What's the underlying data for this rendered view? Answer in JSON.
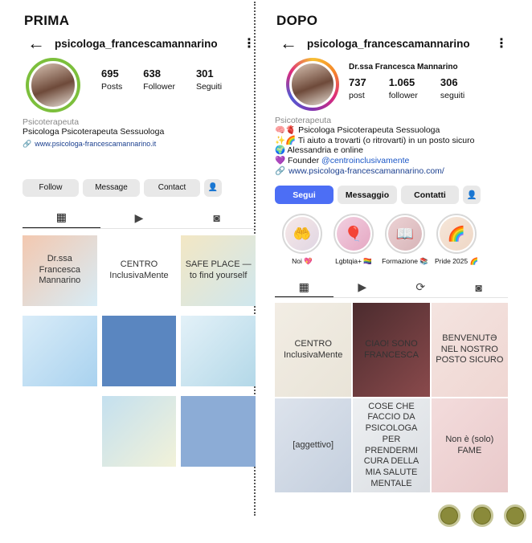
{
  "left_title": "PRIMA",
  "right_title": "DOPO",
  "before": {
    "username": "psicologa_francescamannarino",
    "stats": [
      {
        "num": "695",
        "label": "Posts"
      },
      {
        "num": "638",
        "label": "Follower"
      },
      {
        "num": "301",
        "label": "Seguiti"
      }
    ],
    "category": "Psicoterapeuta",
    "bio": "Psicologa Psicoterapeuta  Sessuologa",
    "link": "www.psicologa-francescamannarino.it",
    "buttons": {
      "follow": "Follow",
      "message": "Message",
      "contact": "Contact"
    },
    "posts": [
      {
        "text": "Dr.ssa Francesca Mannarino",
        "bg": "linear-gradient(135deg,#f3c8b0,#d7ecf6)"
      },
      {
        "text": "CENTRO InclusivaMente",
        "bg": "#ffffff"
      },
      {
        "text": "SAFE PLACE — to find yourself",
        "bg": "linear-gradient(135deg,#f3e7c4,#cfe7ee)"
      },
      {
        "text": "",
        "bg": "linear-gradient(135deg,#d9ecf8,#a9d2ef)"
      },
      {
        "text": "",
        "bg": "#5a86c0"
      },
      {
        "text": "",
        "bg": "linear-gradient(135deg,#e3f1f8,#b3d8e8)"
      },
      {
        "text": "",
        "bg": "#ffffff"
      },
      {
        "text": "",
        "bg": "linear-gradient(135deg,#c4e0ef,#f2f2d9)"
      },
      {
        "text": "",
        "bg": "#8cacd6"
      }
    ]
  },
  "after": {
    "username": "psicologa_francescamannarino",
    "full_name": "Dr.ssa Francesca Mannarino",
    "stats": [
      {
        "num": "737",
        "label": "post"
      },
      {
        "num": "1.065",
        "label": "follower"
      },
      {
        "num": "306",
        "label": "seguiti"
      }
    ],
    "category": "Psicoterapeuta",
    "bio_lines": [
      "🧠🫀 Psicologa Psicoterapeuta Sessuologa",
      "✨🌈 Ti aiuto a trovarti (o ritrovarti) in un posto sicuro",
      "🌍 Alessandria e online"
    ],
    "founder_prefix": "💜 Founder ",
    "founder_mention": "@centroinclusivamente",
    "link": "www.psicologa-francescamannarino.com/",
    "buttons": {
      "follow": "Segui",
      "message": "Messaggio",
      "contact": "Contatti"
    },
    "highlights": [
      {
        "label": "Noi 💖",
        "icon": "🤲",
        "bg": "linear-gradient(135deg,#f7e8e6,#e0d6e4)"
      },
      {
        "label": "Lgbtqia+ 🏳️‍🌈",
        "icon": "🎈",
        "bg": "linear-gradient(135deg,#f2cfe0,#e5a8c3)"
      },
      {
        "label": "Formazione 📚",
        "icon": "📖",
        "bg": "linear-gradient(135deg,#ecd2d4,#d7b4b8)"
      },
      {
        "label": "Pride 2025 🌈",
        "icon": "🌈",
        "bg": "linear-gradient(135deg,#f5e6d8,#efd7c6)"
      }
    ],
    "posts": [
      {
        "text": "CENTRO InclusivaMente",
        "bg": "linear-gradient(135deg,#f2ede4,#e9e4d8)"
      },
      {
        "text": "CIAO! SONO FRANCESCA",
        "bg": "linear-gradient(135deg,#4b2b2e,#8a4a4c)"
      },
      {
        "text": "BENVENUTƏ NEL NOSTRO POSTO SICURO",
        "bg": "linear-gradient(135deg,#f4e4e0,#efd6d2)"
      },
      {
        "text": "[aggettivo]",
        "bg": "linear-gradient(135deg,#dde3ec,#c4cfde)"
      },
      {
        "text": "COSE CHE FACCIO DA PSICOLOGA PER PRENDERMI CURA DELLA MIA SALUTE MENTALE",
        "bg": "linear-gradient(135deg,#eef0f2,#d9dde2)"
      },
      {
        "text": "Non è (solo) FAME",
        "bg": "linear-gradient(135deg,#f3dcdc,#e9c9ca)"
      }
    ]
  },
  "accent_colors": {
    "olive": "#8a8a3a",
    "blue": "#4c6ef5",
    "avatar_ring_old": "#7cbf3c"
  }
}
